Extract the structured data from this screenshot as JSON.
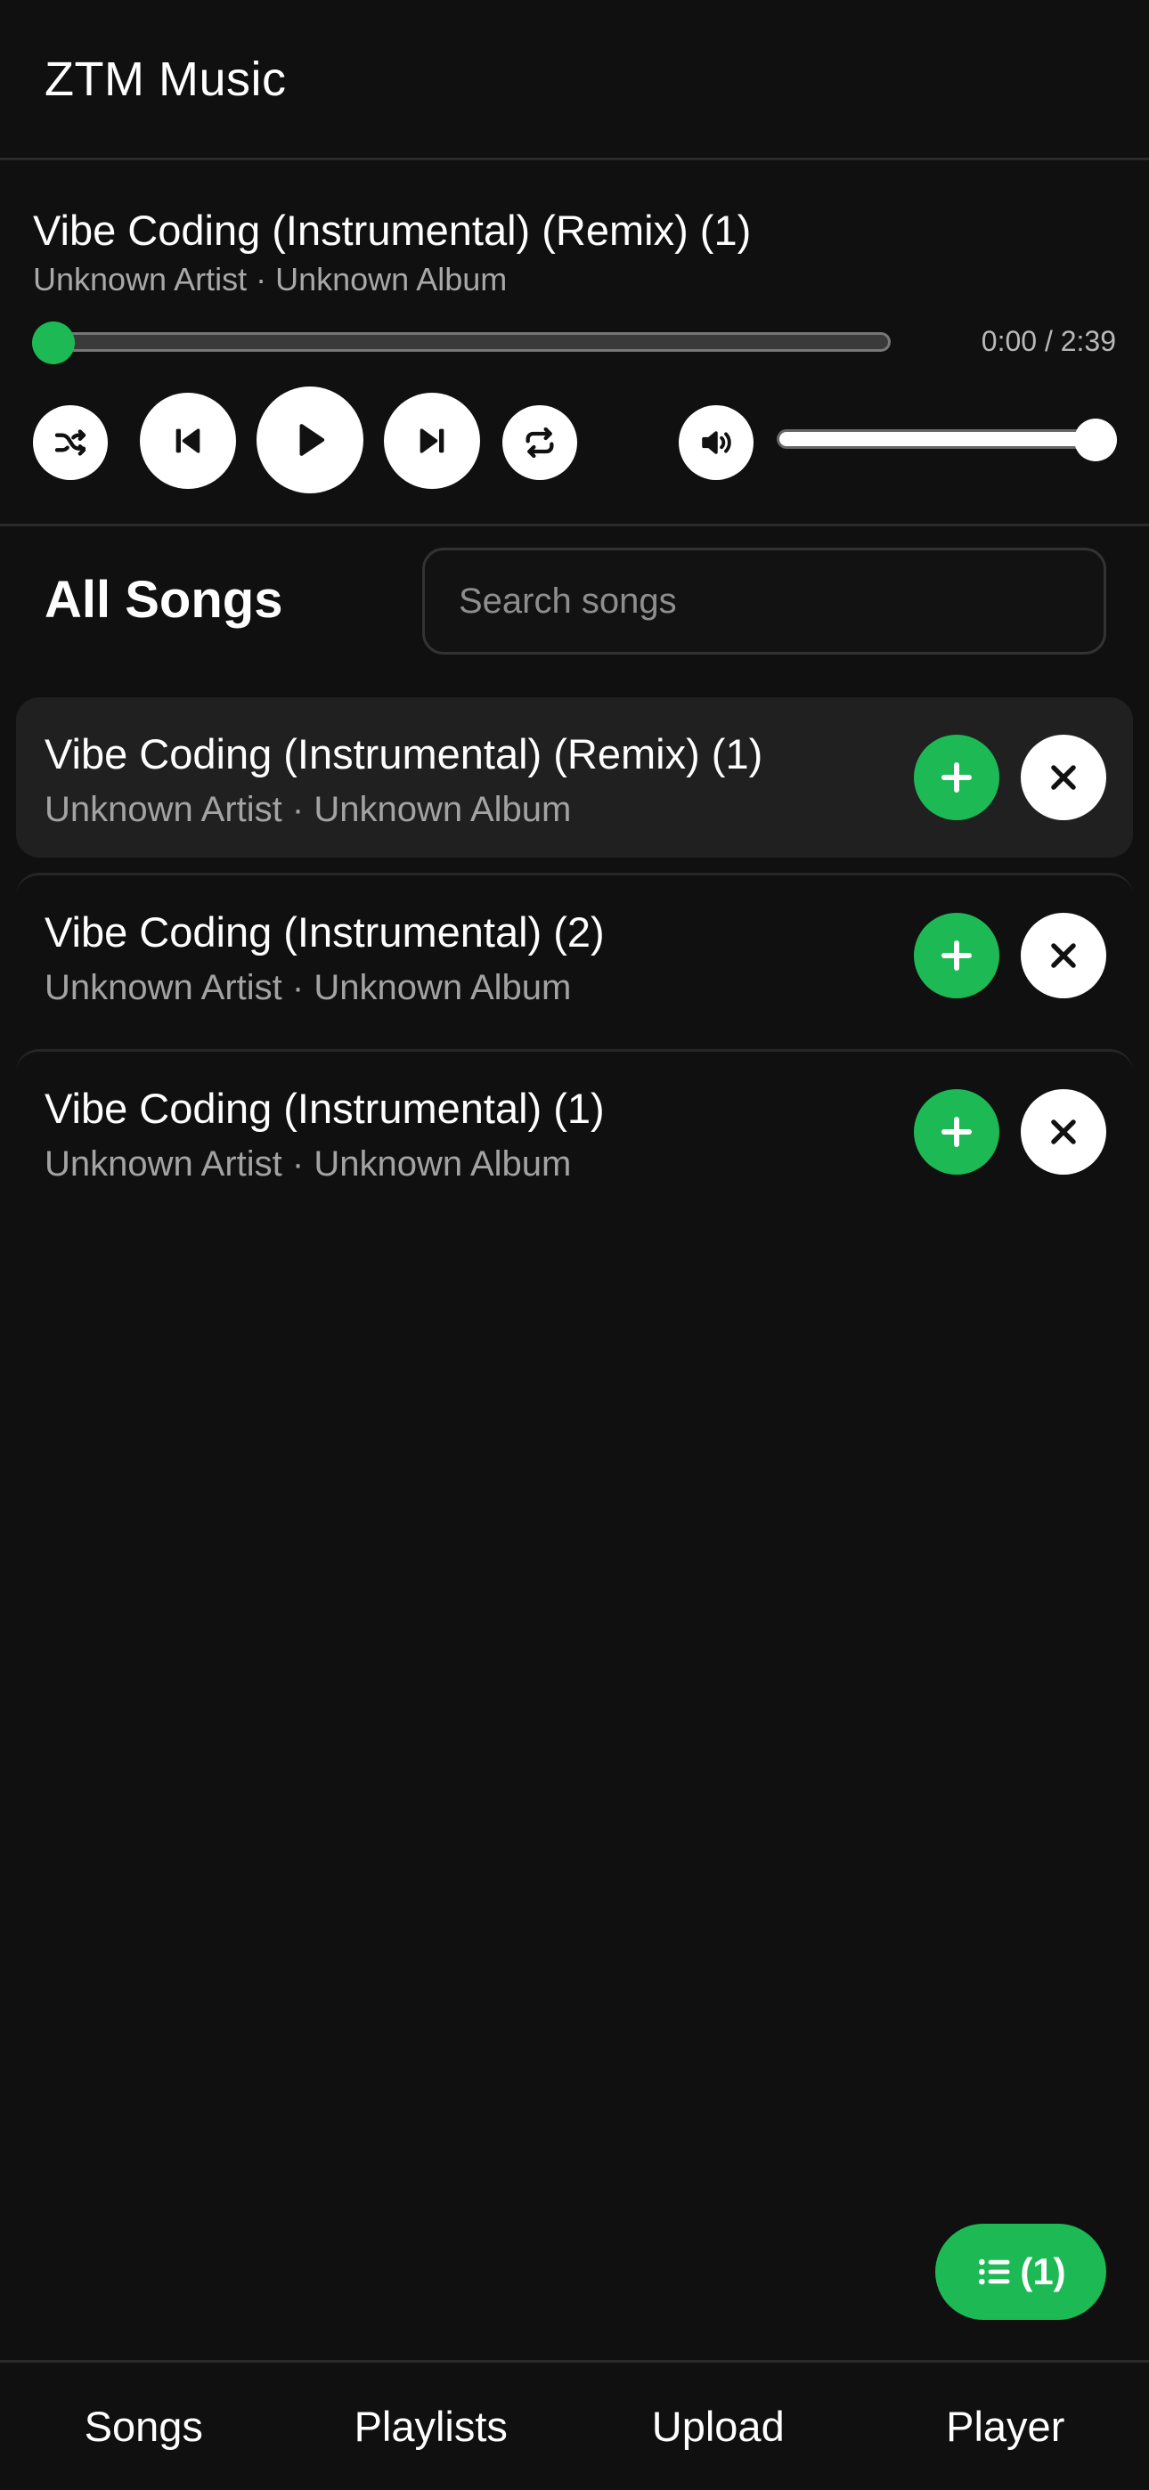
{
  "header": {
    "title": "ZTM Music"
  },
  "now_playing": {
    "title": "Vibe Coding (Instrumental) (Remix) (1)",
    "subtitle": "Unknown Artist · Unknown Album",
    "time": "0:00 / 2:39",
    "progress_fraction": 0.0,
    "volume_fraction": 1.0
  },
  "controls": {
    "shuffle_icon": "shuffle-icon",
    "previous_icon": "skip-previous-icon",
    "play_icon": "play-icon",
    "next_icon": "skip-next-icon",
    "repeat_icon": "repeat-icon",
    "volume_icon": "volume-icon"
  },
  "songs_section": {
    "title": "All Songs",
    "search_placeholder": "Search songs",
    "songs": [
      {
        "title": "Vibe Coding (Instrumental) (Remix) (1)",
        "subtitle": "Unknown Artist · Unknown Album",
        "active": true
      },
      {
        "title": "Vibe Coding (Instrumental) (2)",
        "subtitle": "Unknown Artist · Unknown Album",
        "active": false
      },
      {
        "title": "Vibe Coding (Instrumental) (1)",
        "subtitle": "Unknown Artist · Unknown Album",
        "active": false
      }
    ]
  },
  "queue_button": {
    "label": "(1)",
    "icon": "list-icon"
  },
  "nav": {
    "songs": "Songs",
    "playlists": "Playlists",
    "upload": "Upload",
    "player": "Player"
  },
  "colors": {
    "accent": "#1db954",
    "background": "#101010",
    "active_row": "#202020"
  }
}
